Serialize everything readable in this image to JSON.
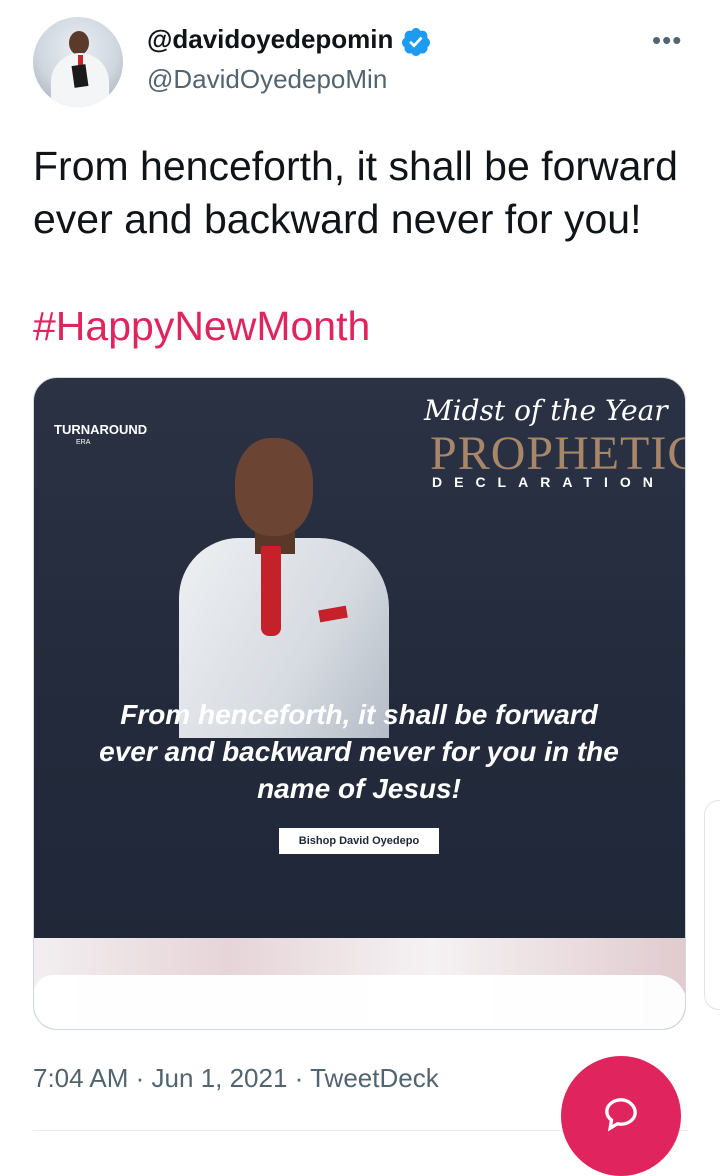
{
  "tweet": {
    "display_name": "@davidoyedepomin",
    "handle": "@DavidOyedepoMin",
    "text": "From henceforth, it shall be forward ever and backward never for you!",
    "hashtag": "#HappyNewMonth",
    "time": "7:04 AM",
    "date": "Jun 1, 2021",
    "source": "TweetDeck",
    "separator": "·"
  },
  "media": {
    "logo_text": "TURNAROUND",
    "logo_sub": "ERA",
    "headline_script": "Midst of the Year",
    "headline_main": "PROPHETIC",
    "headline_sub": "DECLARATION",
    "quote": "From henceforth, it shall be forward ever and backward never for you in the name of Jesus!",
    "signature": "Bishop David Oyedepo"
  },
  "icons": {
    "verified": "verified-badge-icon",
    "more": "more-options-icon",
    "compose": "reply-bubble-icon"
  },
  "colors": {
    "hashtag": "#e0245e",
    "verified": "#1d9bf0",
    "fab": "#e0245e",
    "secondary_text": "#536471"
  }
}
